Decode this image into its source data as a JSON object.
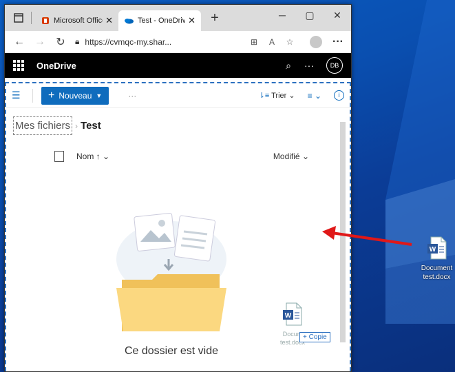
{
  "browser": {
    "tabs": [
      {
        "title": "Microsoft Office",
        "icon": "office-icon"
      },
      {
        "title": "Test - OneDrive",
        "icon": "onedrive-icon"
      }
    ],
    "address": "https://cvmqc-my.shar...",
    "window_controls": [
      "minimize",
      "maximize",
      "close"
    ]
  },
  "suite": {
    "title": "OneDrive",
    "avatar_initials": "DB"
  },
  "command_bar": {
    "new_label": "Nouveau",
    "sort_label": "Trier",
    "more_label": "···"
  },
  "breadcrumb": {
    "root": "Mes fichiers",
    "current": "Test"
  },
  "list_header": {
    "name_col": "Nom ↑",
    "modified_col": "Modifié"
  },
  "empty_state": {
    "message": "Ce dossier est vide"
  },
  "drag": {
    "copy_label": "+ Copie",
    "ghost_label_line1": "Docum",
    "ghost_label_line2": "test.docx"
  },
  "desktop": {
    "file_name_line1": "Document",
    "file_name_line2": "test.docx"
  },
  "colors": {
    "accent": "#0f6cbd",
    "arrow": "#e01818",
    "suitebar": "#000000"
  }
}
